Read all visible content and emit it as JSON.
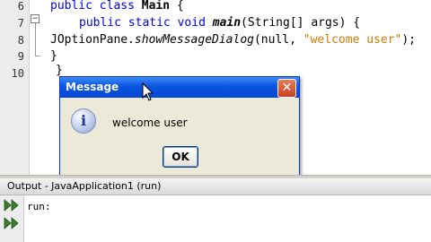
{
  "editor": {
    "line_numbers": [
      "6",
      "7",
      "8",
      "9",
      "10"
    ],
    "lines": {
      "l6_kw1": "public",
      "l6_kw2": "class",
      "l6_name": "Main",
      "l6_rest": " {",
      "l7_kw1": "public",
      "l7_kw2": "static",
      "l7_kw3": "void",
      "l7_method": "main",
      "l7_rest": "(String[] args) {",
      "l8_class": "JOptionPane.",
      "l8_method": "showMessageDialog",
      "l8_args": "(null, ",
      "l8_string": "\"welcome user\"",
      "l8_end": ");",
      "l9": "}",
      "l10": "}"
    }
  },
  "dialog": {
    "title": "Message",
    "message": "welcome user",
    "ok_label": "OK",
    "close_glyph": "✕",
    "icon_glyph": "i"
  },
  "output": {
    "title": "Output - JavaApplication1 (run)",
    "text": "run:"
  }
}
